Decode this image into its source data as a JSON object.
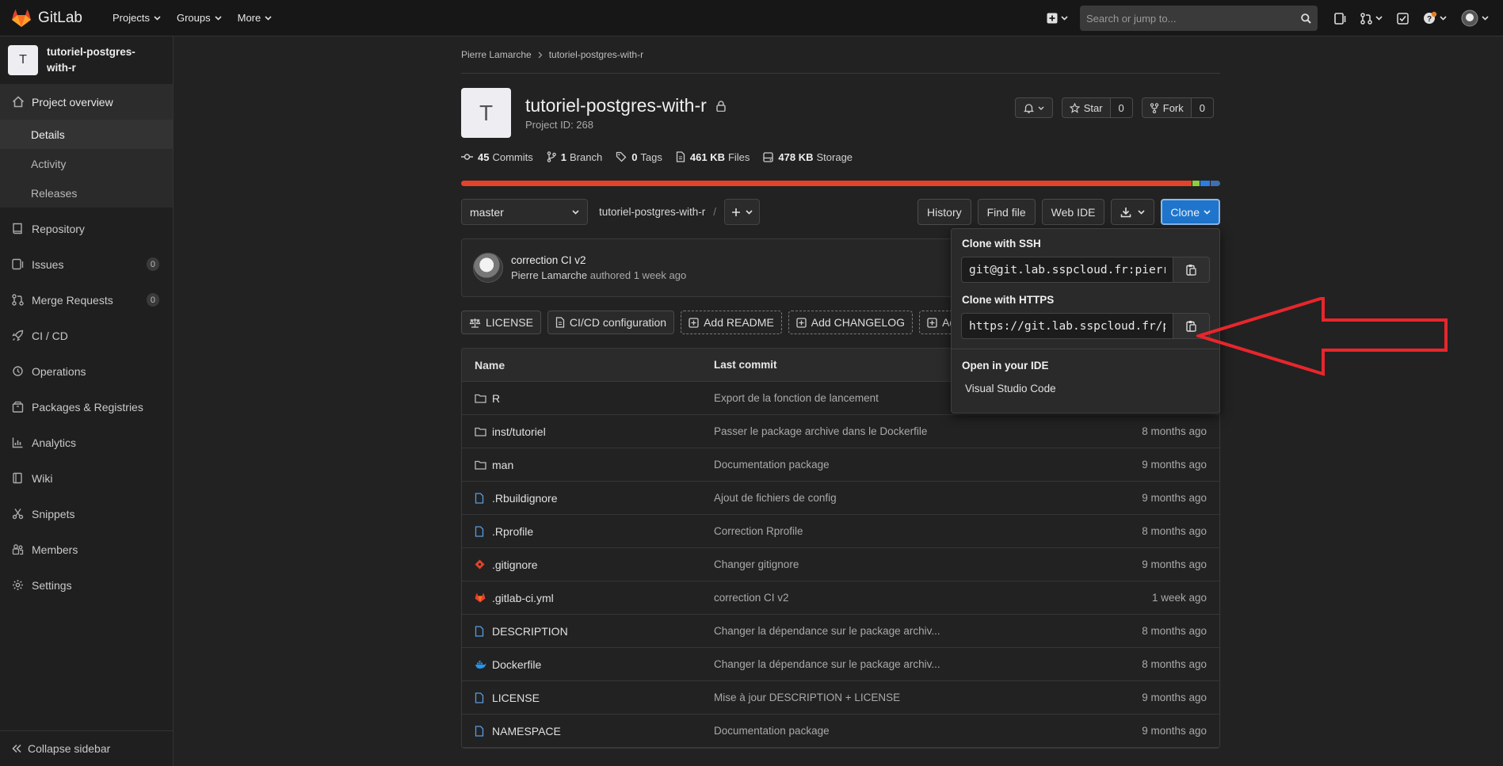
{
  "topbar": {
    "brand": "GitLab",
    "nav": [
      "Projects",
      "Groups",
      "More"
    ],
    "search_placeholder": "Search or jump to..."
  },
  "sidebar": {
    "project_avatar": "T",
    "project_name": "tutoriel-postgres-with-r",
    "overview": "Project overview",
    "overview_items": [
      "Details",
      "Activity",
      "Releases"
    ],
    "items": [
      {
        "label": "Repository",
        "icon": "repository-icon"
      },
      {
        "label": "Issues",
        "icon": "issues-icon",
        "badge": "0"
      },
      {
        "label": "Merge Requests",
        "icon": "merge-request-icon",
        "badge": "0"
      },
      {
        "label": "CI / CD",
        "icon": "rocket-icon"
      },
      {
        "label": "Operations",
        "icon": "operations-icon"
      },
      {
        "label": "Packages & Registries",
        "icon": "package-icon"
      },
      {
        "label": "Analytics",
        "icon": "analytics-icon"
      },
      {
        "label": "Wiki",
        "icon": "book-icon"
      },
      {
        "label": "Snippets",
        "icon": "scissors-icon"
      },
      {
        "label": "Members",
        "icon": "members-icon"
      },
      {
        "label": "Settings",
        "icon": "gear-icon"
      }
    ],
    "collapse": "Collapse sidebar"
  },
  "breadcrumb": [
    "Pierre Lamarche",
    "tutoriel-postgres-with-r"
  ],
  "project": {
    "avatar": "T",
    "title": "tutoriel-postgres-with-r",
    "id_text": "Project ID: 268",
    "star_label": "Star",
    "star_count": "0",
    "fork_label": "Fork",
    "fork_count": "0"
  },
  "stats": [
    {
      "value": "45",
      "label": "Commits"
    },
    {
      "value": "1",
      "label": "Branch"
    },
    {
      "value": "0",
      "label": "Tags"
    },
    {
      "value": "461 KB",
      "label": "Files"
    },
    {
      "value": "478 KB",
      "label": "Storage"
    }
  ],
  "languages": [
    {
      "color": "#e24329",
      "share": 0.965
    },
    {
      "color": "#8fce3b",
      "share": 0.01
    },
    {
      "color": "#2b7de0",
      "share": 0.012
    },
    {
      "color": "#3f6fb0",
      "share": 0.013
    }
  ],
  "toolbar": {
    "branch": "master",
    "path": "tutoriel-postgres-with-r",
    "path_sep": "/",
    "history": "History",
    "find_file": "Find file",
    "web_ide": "Web IDE",
    "clone": "Clone"
  },
  "last_commit": {
    "title": "correction CI v2",
    "author": "Pierre Lamarche",
    "verb": "authored",
    "time": "1 week ago"
  },
  "quick_buttons": [
    {
      "label": "LICENSE",
      "dashed": false
    },
    {
      "label": "CI/CD configuration",
      "dashed": false
    },
    {
      "label": "Add README",
      "dashed": true
    },
    {
      "label": "Add CHANGELOG",
      "dashed": true
    },
    {
      "label": "Add",
      "dashed": true
    }
  ],
  "tree": {
    "headers": [
      "Name",
      "Last commit",
      ""
    ],
    "rows": [
      {
        "name": "R",
        "type": "folder",
        "commit": "Export de la fonction de lancement",
        "date": ""
      },
      {
        "name": "inst/tutoriel",
        "type": "folder",
        "commit": "Passer le package archive dans le Dockerfile",
        "date": "8 months ago"
      },
      {
        "name": "man",
        "type": "folder",
        "commit": "Documentation package",
        "date": "9 months ago"
      },
      {
        "name": ".Rbuildignore",
        "type": "file",
        "commit": "Ajout de fichiers de config",
        "date": "9 months ago"
      },
      {
        "name": ".Rprofile",
        "type": "file",
        "commit": "Correction Rprofile",
        "date": "8 months ago"
      },
      {
        "name": ".gitignore",
        "type": "git",
        "commit": "Changer gitignore",
        "date": "9 months ago"
      },
      {
        "name": ".gitlab-ci.yml",
        "type": "gitlab",
        "commit": "correction CI v2",
        "date": "1 week ago"
      },
      {
        "name": "DESCRIPTION",
        "type": "file",
        "commit": "Changer la dépendance sur le package archiv...",
        "date": "8 months ago"
      },
      {
        "name": "Dockerfile",
        "type": "docker",
        "commit": "Changer la dépendance sur le package archiv...",
        "date": "8 months ago"
      },
      {
        "name": "LICENSE",
        "type": "file",
        "commit": "Mise à jour DESCRIPTION + LICENSE",
        "date": "9 months ago"
      },
      {
        "name": "NAMESPACE",
        "type": "file",
        "commit": "Documentation package",
        "date": "9 months ago"
      }
    ]
  },
  "clone_dropdown": {
    "ssh_label": "Clone with SSH",
    "ssh_url": "git@git.lab.sspcloud.fr:pierre",
    "https_label": "Clone with HTTPS",
    "https_url": "https://git.lab.sspcloud.fr/p",
    "ide_label": "Open in your IDE",
    "ide_item": "Visual Studio Code"
  },
  "colors": {
    "accent": "#1f75cb",
    "arrow": "#e8262c",
    "brand": "#e24329"
  }
}
